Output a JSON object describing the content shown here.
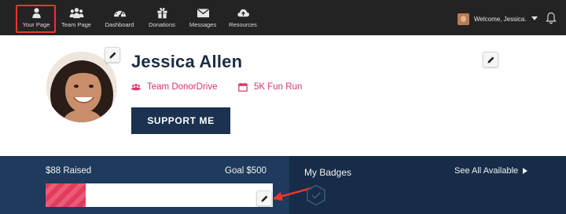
{
  "nav": {
    "items": [
      {
        "label": "Your Page",
        "icon": "user-icon"
      },
      {
        "label": "Team Page",
        "icon": "team-icon"
      },
      {
        "label": "Dashboard",
        "icon": "dashboard-icon"
      },
      {
        "label": "Donations",
        "icon": "gift-icon"
      },
      {
        "label": "Messages",
        "icon": "envelope-icon"
      },
      {
        "label": "Resources",
        "icon": "cloud-icon"
      }
    ],
    "active_index": 0,
    "welcome_text": "Welcome, Jessica."
  },
  "profile": {
    "name": "Jessica Allen",
    "team": "Team DonorDrive",
    "event": "5K Fun Run",
    "support_label": "SUPPORT ME"
  },
  "fundraising": {
    "raised_text": "$88 Raised",
    "goal_text": "Goal $500",
    "progress_fraction": 0.176
  },
  "badges": {
    "title": "My Badges",
    "see_all": "See All Available"
  },
  "colors": {
    "nav_bg": "#232323",
    "highlight_red": "#e8372a",
    "accent_pink": "#d8336b",
    "navy": "#1b3250",
    "name_color": "#1b2b44",
    "band_left": "#1e3a5c",
    "band_right": "#172c48"
  }
}
